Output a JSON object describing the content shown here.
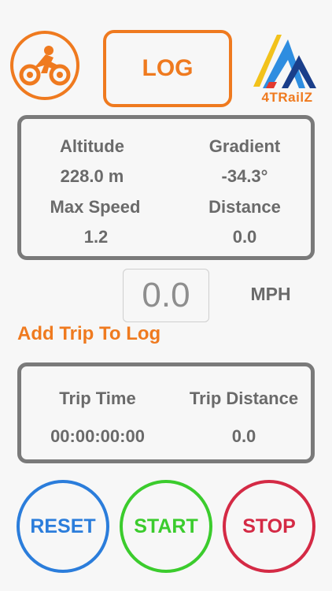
{
  "colors": {
    "accent": "#ef7a1f",
    "panel_border": "#7a7a7a",
    "text": "#6a6a6a",
    "reset": "#2b7ddb",
    "start": "#3bcc2d",
    "stop": "#d42a45"
  },
  "header": {
    "bike_icon": "motorcycle-rider-icon",
    "log_label": "LOG",
    "brand_name": "4TRailZ"
  },
  "stats": {
    "altitude_label": "Altitude",
    "altitude_value": "228.0 m",
    "gradient_label": "Gradient",
    "gradient_value": "-34.3°",
    "max_speed_label": "Max Speed",
    "max_speed_value": "1.2",
    "distance_label": "Distance",
    "distance_value": "0.0"
  },
  "speed": {
    "value": "0.0",
    "unit": "MPH"
  },
  "add_trip_label": "Add Trip To Log",
  "trip": {
    "time_label": "Trip Time",
    "time_value": "00:00:00:00",
    "distance_label": "Trip Distance",
    "distance_value": "0.0"
  },
  "controls": {
    "reset_label": "RESET",
    "start_label": "START",
    "stop_label": "STOP"
  }
}
